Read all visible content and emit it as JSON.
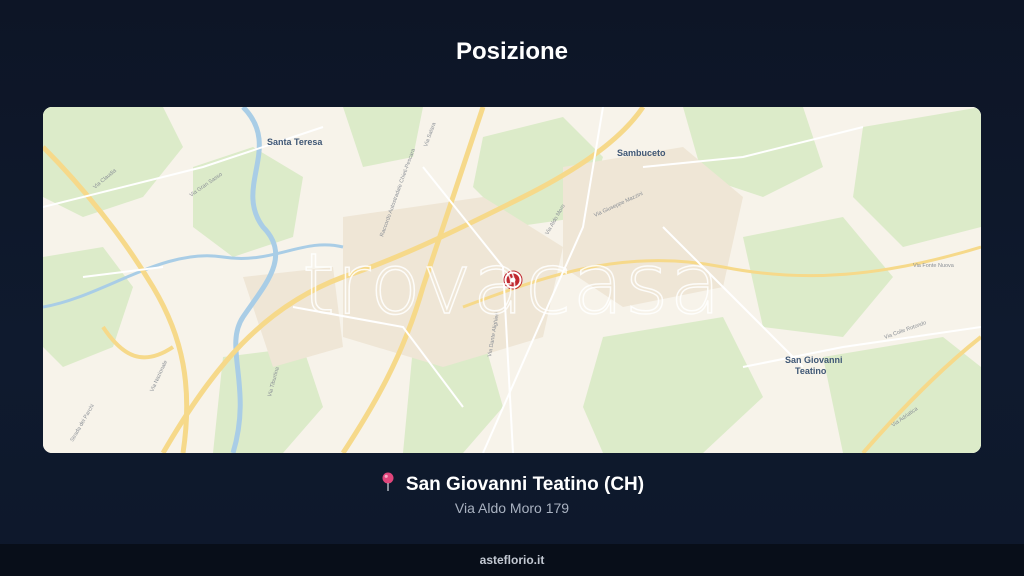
{
  "page": {
    "title": "Posizione"
  },
  "map": {
    "watermark": "trovacasa",
    "place_labels": [
      "Santa Teresa",
      "Sambuceto",
      "San Giovanni",
      "Teatino"
    ],
    "street_labels": [
      "Via Claudia",
      "Via Gran Sasso",
      "Via Aldo Moro",
      "Via Giuseppe Mazzini",
      "Raccordo Autostradale Chieti-Pescara",
      "Via Tiburtina",
      "Via Adriatica",
      "Via Nazionale",
      "Strada dei Parchi",
      "Via Fonte Nuova",
      "Via Colle Rotondo",
      "Via Dante Alighieri",
      "Via Salara"
    ],
    "marker_icon": "location-marker-icon"
  },
  "location": {
    "icon": "pin-icon",
    "city": "San Giovanni Teatino (CH)",
    "address": "Via Aldo Moro 179"
  },
  "footer": {
    "brand": "asteflorio.it"
  }
}
